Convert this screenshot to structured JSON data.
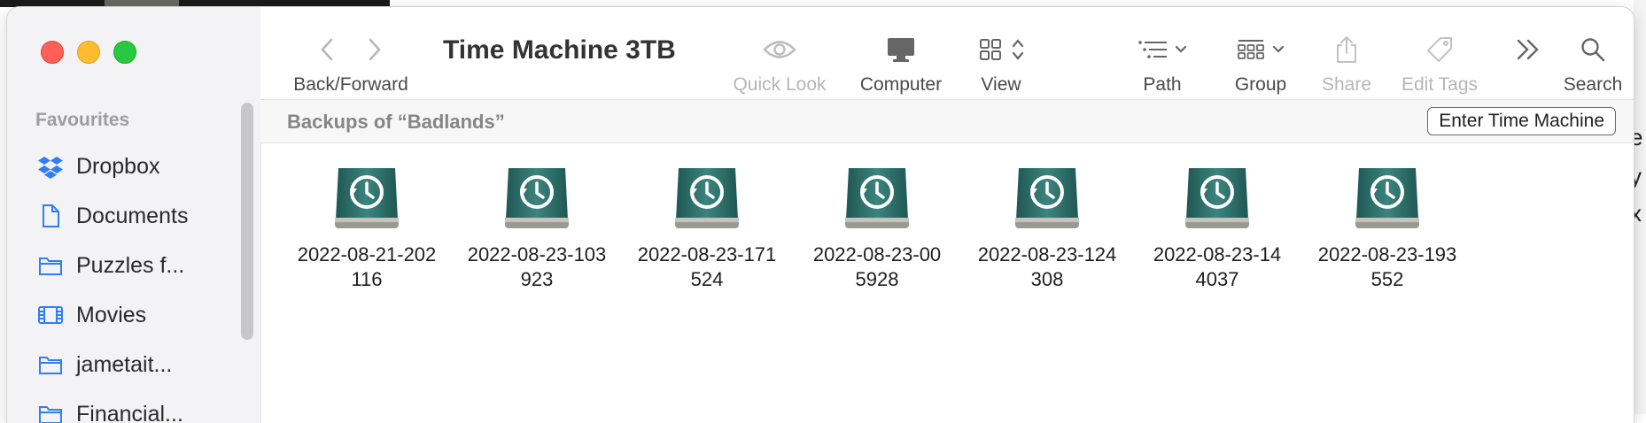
{
  "window": {
    "title": "Time Machine 3TB"
  },
  "sidebar": {
    "heading": "Favourites",
    "items": [
      {
        "label": "Dropbox",
        "icon": "dropbox-icon"
      },
      {
        "label": "Documents",
        "icon": "document-icon"
      },
      {
        "label": "Puzzles f...",
        "icon": "folder-icon"
      },
      {
        "label": "Movies",
        "icon": "film-icon"
      },
      {
        "label": "jametait...",
        "icon": "folder-icon"
      },
      {
        "label": "Financial...",
        "icon": "folder-icon"
      }
    ]
  },
  "toolbar": {
    "back_forward": "Back/Forward",
    "quick_look": "Quick Look",
    "computer": "Computer",
    "view": "View",
    "path": "Path",
    "group": "Group",
    "share": "Share",
    "edit_tags": "Edit Tags",
    "search": "Search"
  },
  "pathbar": {
    "caption": "Backups of “Badlands”",
    "enter_button": "Enter Time Machine"
  },
  "backups": [
    {
      "line1": "2022-08-21-202",
      "line2": "116"
    },
    {
      "line1": "2022-08-23-103",
      "line2": "923"
    },
    {
      "line1": "2022-08-23-171",
      "line2": "524"
    },
    {
      "line1": "2022-08-23-00",
      "line2": "5928"
    },
    {
      "line1": "2022-08-23-124",
      "line2": "308"
    },
    {
      "line1": "2022-08-23-14",
      "line2": "4037"
    },
    {
      "line1": "2022-08-23-193",
      "line2": "552"
    }
  ],
  "colors": {
    "drive_teal": "#2f6f6a",
    "accent_blue": "#2f7ef5"
  }
}
